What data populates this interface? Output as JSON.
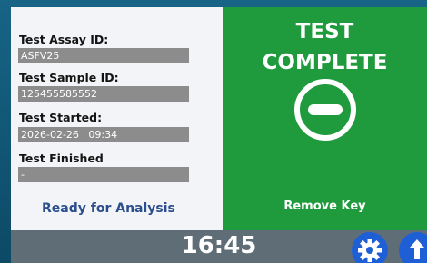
{
  "fields": [
    {
      "label": "Test Assay ID:",
      "value": "ASFV25"
    },
    {
      "label": "Test Sample ID:",
      "value": "125455585552"
    },
    {
      "label": "Test Started:",
      "value": "2026-02-26   09:34"
    },
    {
      "label": "Test Finished",
      "value": "-"
    }
  ],
  "status": "Ready for Analysis",
  "result": {
    "line1": "TEST",
    "line2": "COMPLETE",
    "icon": "minus-circle-icon",
    "instruction": "Remove Key"
  },
  "clock": "16:45",
  "bottom_buttons": [
    {
      "icon": "gear-icon"
    },
    {
      "icon": "upload-icon"
    }
  ],
  "colors": {
    "result_panel": "#1f9a3c",
    "status_text": "#2b4e8e",
    "bottom_bar": "#5f6e76",
    "button": "#1f5fd6"
  }
}
